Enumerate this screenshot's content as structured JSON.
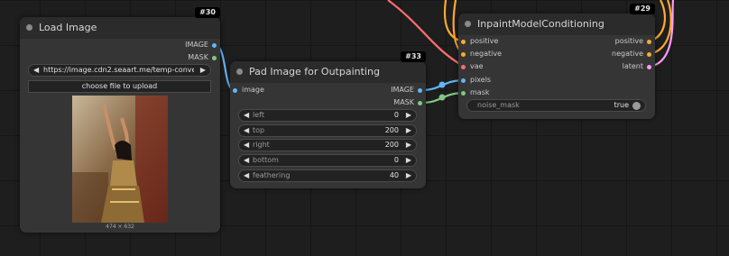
{
  "colors": {
    "image": "#64b5f6",
    "mask": "#81c784",
    "vae": "#ff6e6e",
    "conditioning": "#ffa931",
    "latent": "#ff9cf9"
  },
  "nodes": {
    "load_image": {
      "id": "#30",
      "title": "Load Image",
      "outputs": [
        "IMAGE",
        "MASK"
      ],
      "image_url": "https://image.cdn2.seaart.me/temp-conver ...",
      "upload_label": "choose file to upload",
      "image_size": "474 × 632"
    },
    "pad_image": {
      "id": "#33",
      "title": "Pad Image for Outpainting",
      "input": "image",
      "outputs": [
        "IMAGE",
        "MASK"
      ],
      "widgets": [
        {
          "label": "left",
          "value": "0"
        },
        {
          "label": "top",
          "value": "200"
        },
        {
          "label": "right",
          "value": "200"
        },
        {
          "label": "bottom",
          "value": "0"
        },
        {
          "label": "feathering",
          "value": "40"
        }
      ]
    },
    "inpaint": {
      "id": "#29",
      "title": "InpaintModelConditioning",
      "inputs": [
        "positive",
        "negative",
        "vae",
        "pixels",
        "mask"
      ],
      "outputs": [
        "positive",
        "negative",
        "latent"
      ],
      "noise_mask_label": "noise_mask",
      "noise_mask_value": "true"
    }
  }
}
